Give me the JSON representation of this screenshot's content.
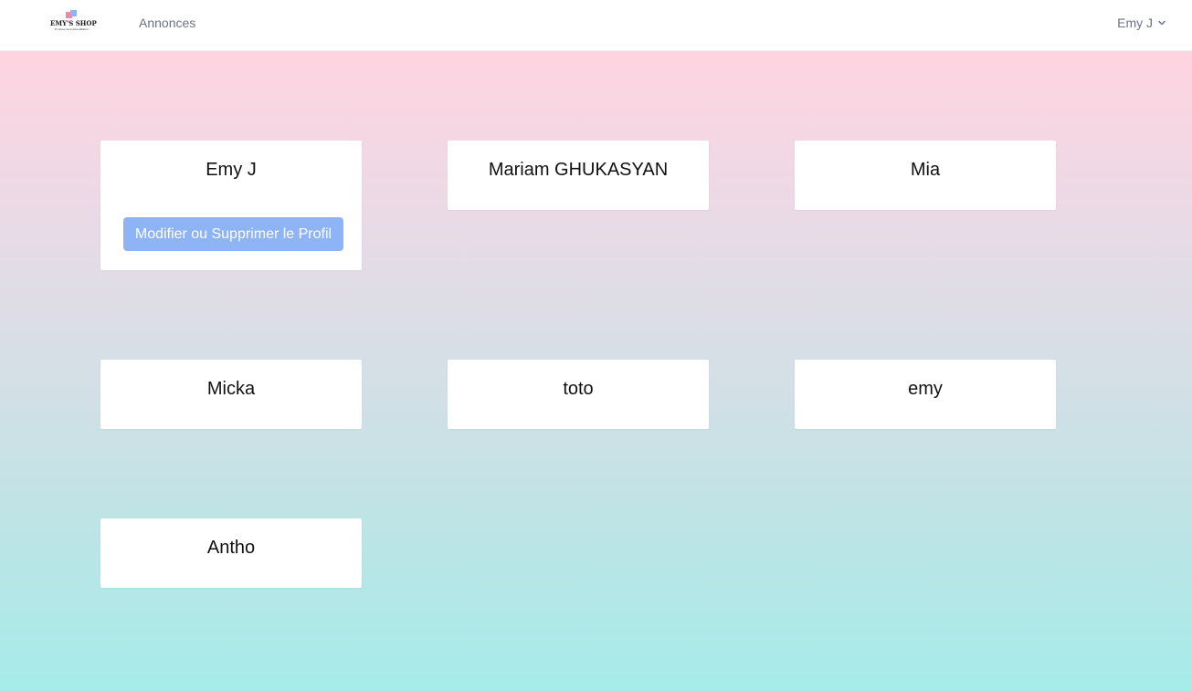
{
  "header": {
    "logo": {
      "title": "EMY'S SHOP",
      "tagline": "Trouvez la bonne affaire !",
      "icon": "shopping-bag-icon"
    },
    "nav_link": "Annonces",
    "user_menu": {
      "name": "Emy J",
      "icon": "chevron-down-icon"
    }
  },
  "profiles": [
    {
      "name": "Emy J",
      "action_label": "Modifier ou Supprimer le Profil"
    },
    {
      "name": "Mariam GHUKASYAN"
    },
    {
      "name": "Mia"
    },
    {
      "name": "Micka"
    },
    {
      "name": "toto"
    },
    {
      "name": "emy"
    },
    {
      "name": "Antho"
    }
  ],
  "colors": {
    "gradient_top": "#ffd4e1",
    "gradient_bottom": "#a5ece9",
    "button": "#8fb4f5",
    "nav_text": "#6b7280"
  }
}
